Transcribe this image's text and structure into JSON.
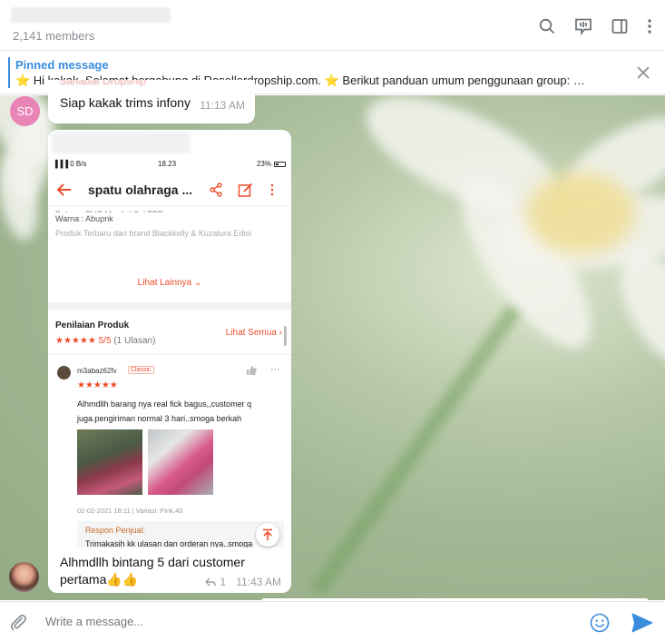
{
  "header": {
    "members": "2,141 members",
    "icons": [
      "search-icon",
      "voice-chat-icon",
      "sidebar-toggle-icon",
      "more-vertical-icon"
    ]
  },
  "pinned": {
    "title": "Pinned message",
    "text": "⭐️ Hi kakak. Selamat bergabung di Resellerdropship.com. ⭐️  Berikut panduan umum penggunaan group:  …"
  },
  "messages": [
    {
      "avatar_initials": "SD",
      "avatar_color": "#e884b6",
      "sender_partial": "Sahabat Dropship",
      "text": "Siap kakak trims infony",
      "time": "11:13 AM"
    },
    {
      "caption_line1": "Alhmdllh bintang 5 dari customer",
      "caption_line2": "pertama👍👍",
      "reply_count": "1",
      "time": "11:43 AM",
      "screenshot": {
        "status_left": "▐▐▐ 0 B/s",
        "status_time": "18.23",
        "status_battery": "23%",
        "title": "spatu olahraga ...",
        "desc_cut": "Bahan : PVC Masih / Sol TPR",
        "desc_warna": "Warna : Abupnk",
        "desc_fade": "Produk Terbaru dari brand Blackkelly & Kuzatura Edisi",
        "lihat_lainnya": "Lihat Lainnya",
        "penilaian_title": "Penilaian Produk",
        "rating_stars": "★★★★★",
        "rating_score": "5/5",
        "rating_count": "(1 Ulasan)",
        "lihat_semua": "Lihat Semua",
        "reviewer": "m3abaz62fv",
        "reviewer_badge": "Classic",
        "review_stars": "★★★★★",
        "review_text": "Alhmdllh barang nya real fick bagus,,customer q juga.pengiriman normal 3 hari..smoga berkah",
        "review_date": "02-02-2021 18:11 | Variasi: Pink,40",
        "respon_title": "Respon Penjual:",
        "respon_text": "Trimakasih kk ulasan dan orderan nya..smoga awet dan lancar rejeki nya..."
      }
    }
  ],
  "composer": {
    "placeholder": "Write a message..."
  },
  "colors": {
    "accent": "#3a8dde",
    "shopee": "#ee4d2d"
  }
}
